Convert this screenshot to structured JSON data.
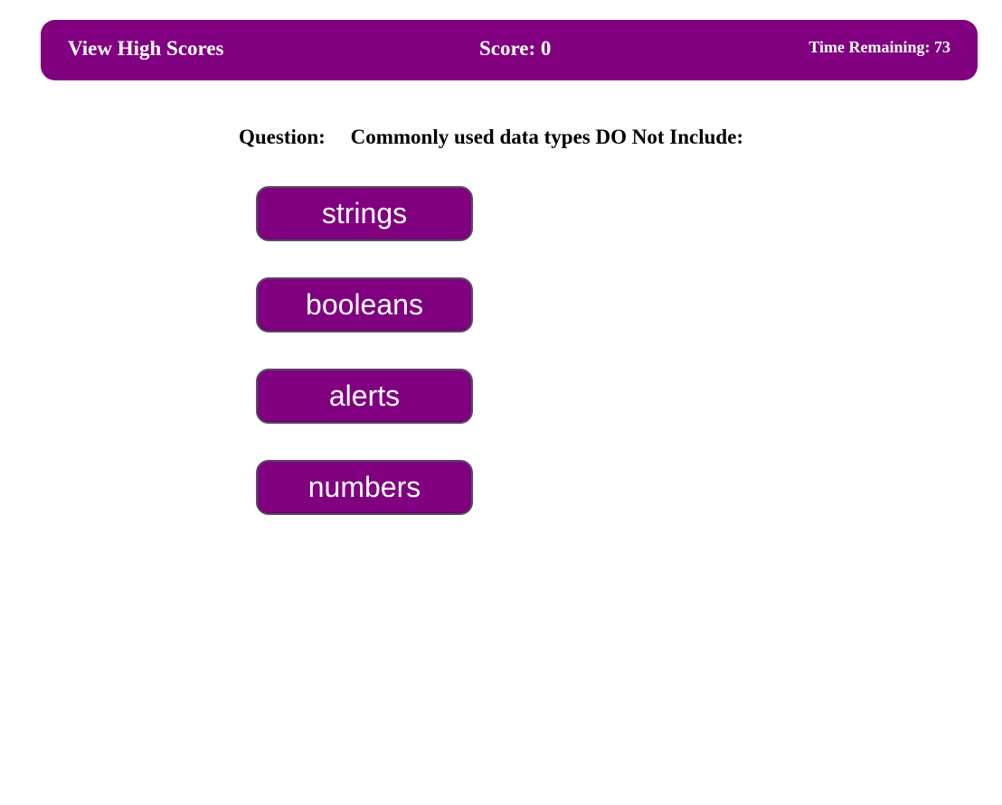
{
  "header": {
    "view_high_scores": "View High Scores",
    "score_label": "Score: 0",
    "time_label": "Time Remaining: 73"
  },
  "quiz": {
    "question_label": "Question:",
    "question_text": "Commonly used data types DO Not Include:",
    "answers": [
      "strings",
      "booleans",
      "alerts",
      "numbers"
    ]
  },
  "colors": {
    "accent": "#800080",
    "text_on_accent": "#ffffff",
    "button_border": "#5a4a66"
  }
}
